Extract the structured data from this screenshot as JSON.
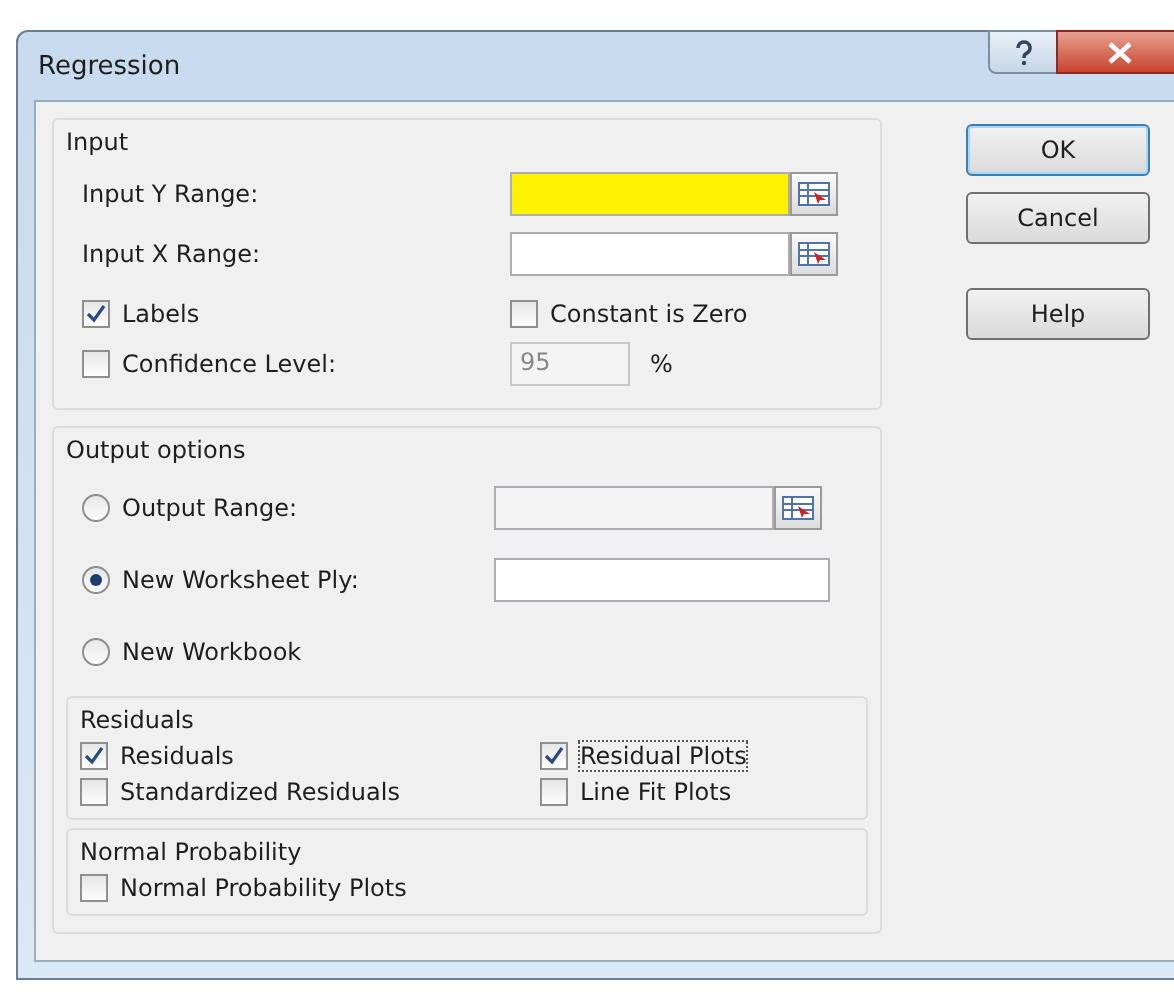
{
  "window": {
    "title": "Regression"
  },
  "input": {
    "title": "Input",
    "ranges": [
      {
        "label": "Input Y Range:",
        "highlighted": true
      },
      {
        "label": "Input X Range:",
        "highlighted": false
      }
    ],
    "labels": {
      "label": "Labels",
      "checked": true
    },
    "constant_zero": {
      "label": "Constant is Zero",
      "checked": false
    },
    "confidence": {
      "label": "Confidence Level:",
      "checked": false,
      "value": "95",
      "unit": "%"
    }
  },
  "output": {
    "title": "Output options",
    "destinations": [
      {
        "label": "Output Range:",
        "selected": false,
        "kind": "range"
      },
      {
        "label": "New Worksheet Ply:",
        "selected": true,
        "kind": "text"
      },
      {
        "label": "New Workbook",
        "selected": false,
        "kind": "none"
      }
    ],
    "residuals": {
      "title": "Residuals",
      "options": [
        {
          "label": "Residuals",
          "checked": true,
          "focused": false
        },
        {
          "label": "Residual Plots",
          "checked": true,
          "focused": true
        },
        {
          "label": "Standardized Residuals",
          "checked": false,
          "focused": false
        },
        {
          "label": "Line Fit Plots",
          "checked": false,
          "focused": false
        }
      ]
    },
    "normal_probability": {
      "title": "Normal Probability",
      "options": [
        {
          "label": "Normal Probability Plots",
          "checked": false,
          "focused": false
        }
      ]
    }
  },
  "buttons": [
    {
      "label": "OK",
      "default": true
    },
    {
      "label": "Cancel",
      "default": false
    },
    {
      "label": "Help",
      "default": false
    }
  ]
}
